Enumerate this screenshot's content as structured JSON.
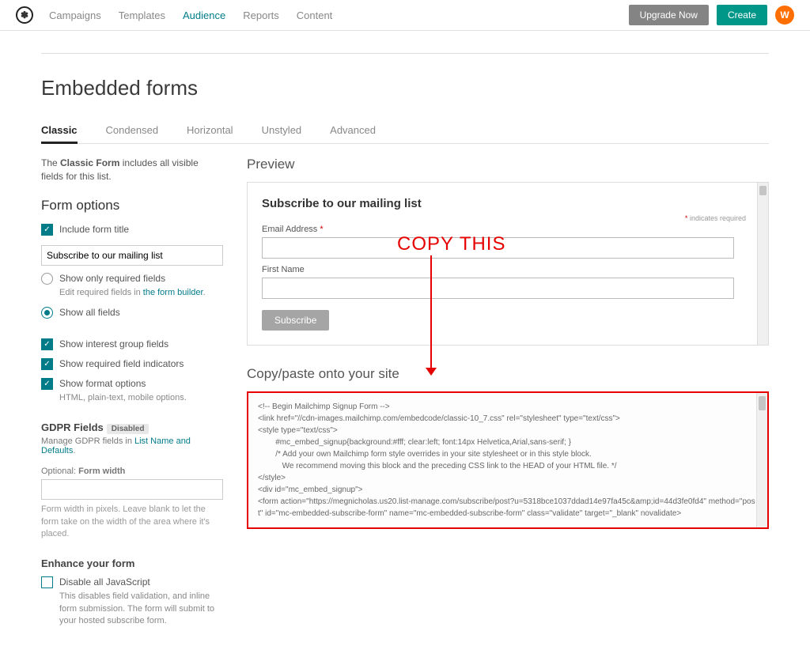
{
  "nav": {
    "items": [
      "Campaigns",
      "Templates",
      "Audience",
      "Reports",
      "Content"
    ],
    "active_index": 2,
    "upgrade": "Upgrade Now",
    "create": "Create",
    "avatar": "W"
  },
  "page": {
    "title": "Embedded forms",
    "tabs": [
      "Classic",
      "Condensed",
      "Horizontal",
      "Unstyled",
      "Advanced"
    ],
    "active_tab": 0
  },
  "left": {
    "intro_pre": "The ",
    "intro_bold": "Classic Form",
    "intro_post": " includes all visible fields for this list.",
    "form_options": "Form options",
    "opt_include_title": "Include form title",
    "title_value": "Subscribe to our mailing list",
    "opt_required_only": "Show only required fields",
    "opt_required_sub": "Edit required fields in ",
    "opt_required_link": "the form builder",
    "opt_all_fields": "Show all fields",
    "opt_interest": "Show interest group fields",
    "opt_indicators": "Show required field indicators",
    "opt_format": "Show format options",
    "opt_format_sub": "HTML, plain-text, mobile options.",
    "gdpr_label": "GDPR Fields",
    "gdpr_badge": "Disabled",
    "gdpr_text": "Manage GDPR fields in ",
    "gdpr_link": "List Name and Defaults",
    "width_label": "Optional: ",
    "width_bold": "Form width",
    "width_hint": "Form width in pixels. Leave blank to let the form take on the width of the area where it's placed.",
    "enhance": "Enhance your form",
    "disable_js": "Disable all JavaScript",
    "disable_js_sub": "This disables field validation, and inline form submission. The form will submit to your hosted subscribe form."
  },
  "right": {
    "preview_h": "Preview",
    "preview_title": "Subscribe to our mailing list",
    "req_text": "indicates required",
    "email_lbl": "Email Address",
    "fname_lbl": "First Name",
    "subscribe": "Subscribe",
    "copy_h": "Copy/paste onto your site",
    "annotation": "COPY THIS",
    "code": "<!-- Begin Mailchimp Signup Form -->\n<link href=\"//cdn-images.mailchimp.com/embedcode/classic-10_7.css\" rel=\"stylesheet\" type=\"text/css\">\n<style type=\"text/css\">\n        #mc_embed_signup{background:#fff; clear:left; font:14px Helvetica,Arial,sans-serif; }\n        /* Add your own Mailchimp form style overrides in your site stylesheet or in this style block.\n           We recommend moving this block and the preceding CSS link to the HEAD of your HTML file. */\n</style>\n<div id=\"mc_embed_signup\">\n<form action=\"https://megnicholas.us20.list-manage.com/subscribe/post?u=5318bce1037ddad14e97fa45c&amp;id=44d3fe0fd4\" method=\"post\" id=\"mc-embedded-subscribe-form\" name=\"mc-embedded-subscribe-form\" class=\"validate\" target=\"_blank\" novalidate>"
  }
}
